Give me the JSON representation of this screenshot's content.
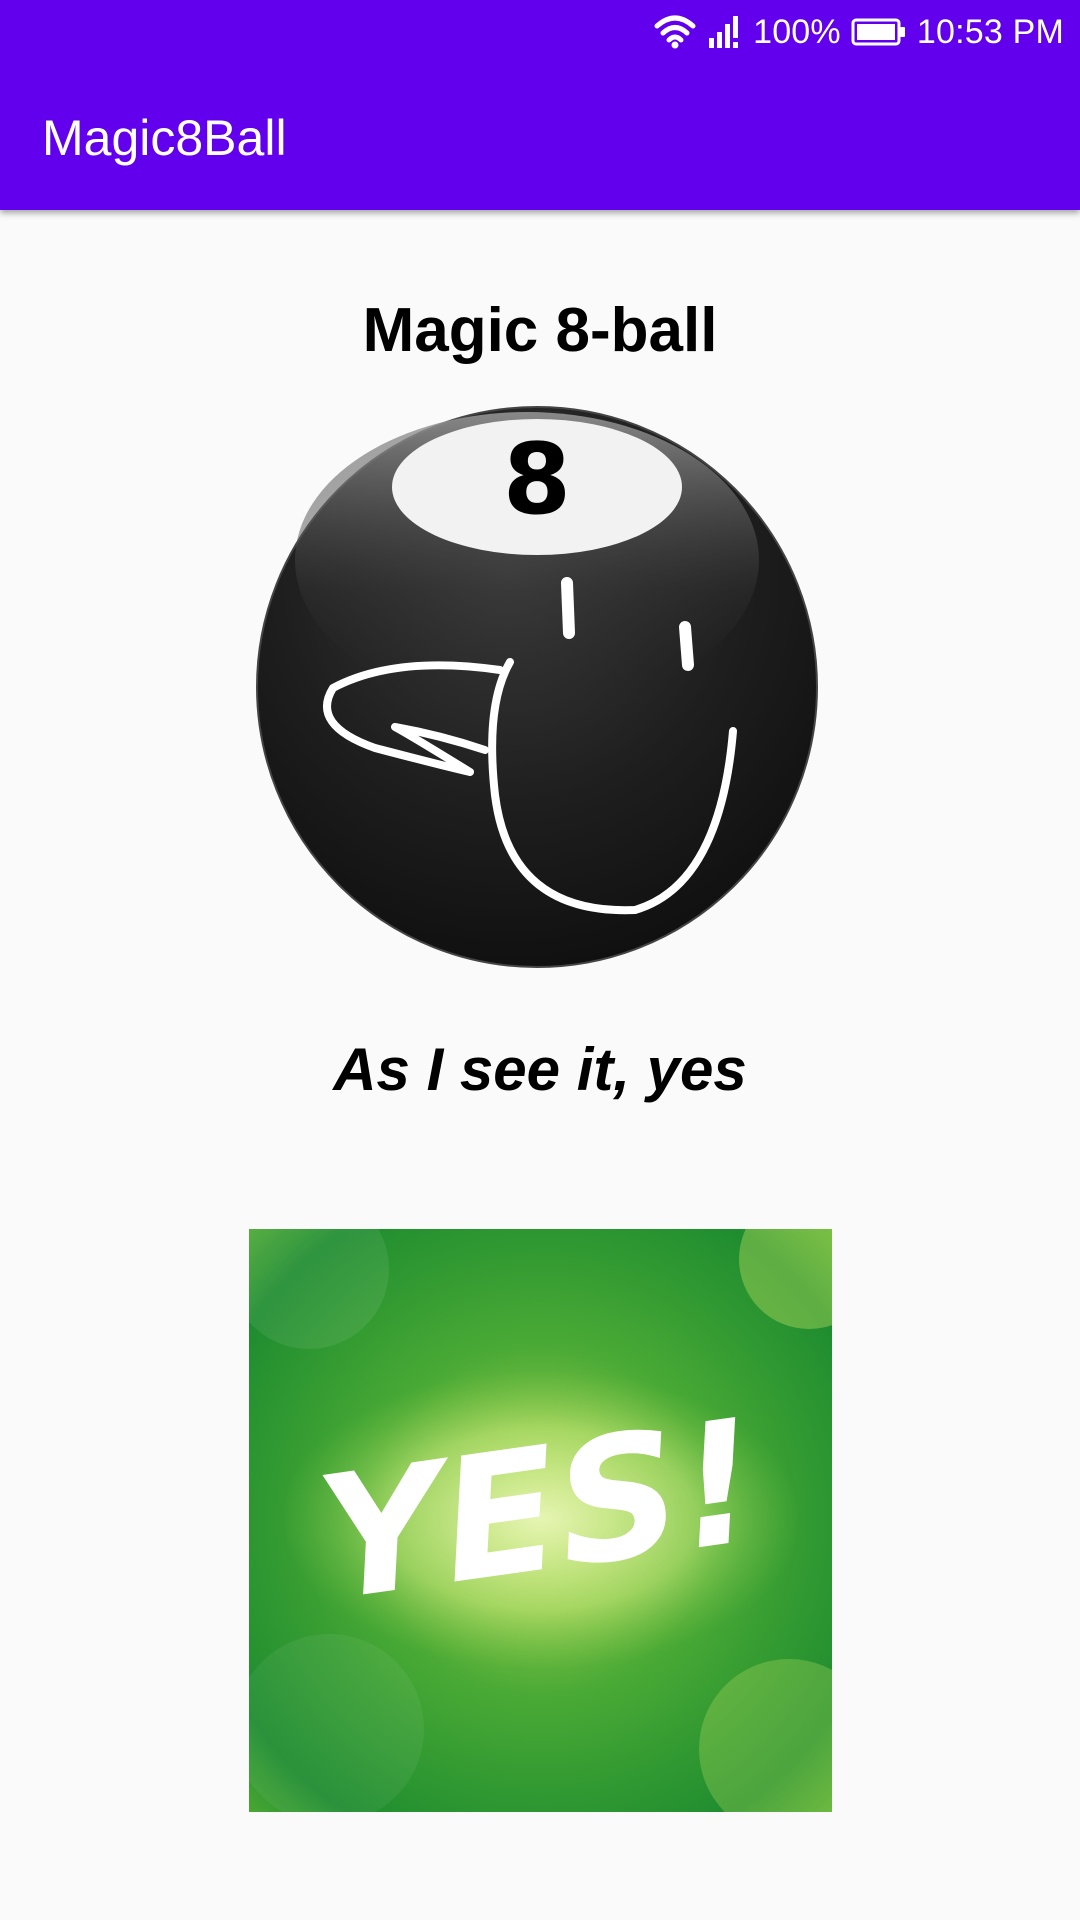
{
  "status_bar": {
    "battery": "100%",
    "time": "10:53 PM",
    "icons": [
      "wifi-icon",
      "cell-signal-icon",
      "battery-icon"
    ]
  },
  "app_bar": {
    "title": "Magic8Ball",
    "background_color": "#6200ee"
  },
  "main": {
    "heading": "Magic 8-ball",
    "ball_number": "8",
    "answer": "As I see it, yes",
    "answer_image_text": "YES!"
  },
  "colors": {
    "primary": "#6200ee",
    "background": "#fafafa",
    "text": "#000000",
    "answer_image_green": "#3aa335"
  }
}
